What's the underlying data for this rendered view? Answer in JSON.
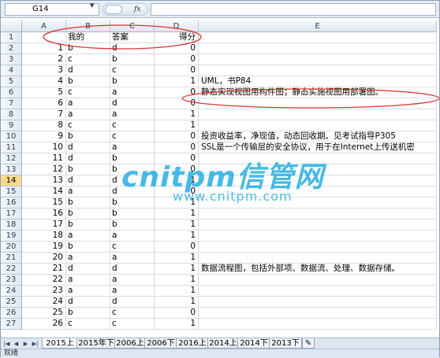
{
  "formula_bar": {
    "name_box": "G14",
    "fx_label": "fx",
    "formula": ""
  },
  "sheet": {
    "columns": [
      "A",
      "B",
      "C",
      "D",
      "E"
    ],
    "header_row": {
      "row": "1",
      "A": "",
      "B": "我的",
      "C": "答案",
      "D": "得分",
      "E": ""
    },
    "active_row": "14",
    "rows": [
      {
        "row": "2",
        "A": "1",
        "B": "b",
        "C": "d",
        "D": "0",
        "E": ""
      },
      {
        "row": "3",
        "A": "2",
        "B": "c",
        "C": "b",
        "D": "0",
        "E": ""
      },
      {
        "row": "4",
        "A": "3",
        "B": "d",
        "C": "c",
        "D": "0",
        "E": ""
      },
      {
        "row": "5",
        "A": "4",
        "B": "b",
        "C": "b",
        "D": "1",
        "E": "UML，书P84"
      },
      {
        "row": "6",
        "A": "5",
        "B": "c",
        "C": "a",
        "D": "0",
        "E": "静态实现视图用构件图；静态实施视图用部署图。"
      },
      {
        "row": "7",
        "A": "6",
        "B": "a",
        "C": "d",
        "D": "0",
        "E": ""
      },
      {
        "row": "8",
        "A": "7",
        "B": "a",
        "C": "a",
        "D": "1",
        "E": ""
      },
      {
        "row": "9",
        "A": "8",
        "B": "c",
        "C": "c",
        "D": "1",
        "E": ""
      },
      {
        "row": "10",
        "A": "9",
        "B": "b",
        "C": "c",
        "D": "0",
        "E": "投资收益率，净现值，动态回收期。见考试指导P305"
      },
      {
        "row": "11",
        "A": "10",
        "B": "d",
        "C": "a",
        "D": "0",
        "E": "SSL是一个传输层的安全协议，用于在Internet上传送机密"
      },
      {
        "row": "12",
        "A": "11",
        "B": "d",
        "C": "b",
        "D": "0",
        "E": ""
      },
      {
        "row": "13",
        "A": "12",
        "B": "b",
        "C": "b",
        "D": "0",
        "E": ""
      },
      {
        "row": "14",
        "A": "13",
        "B": "d",
        "C": "d",
        "D": "1",
        "E": ""
      },
      {
        "row": "15",
        "A": "14",
        "B": "a",
        "C": "d",
        "D": "0",
        "E": ""
      },
      {
        "row": "16",
        "A": "15",
        "B": "b",
        "C": "b",
        "D": "1",
        "E": ""
      },
      {
        "row": "17",
        "A": "16",
        "B": "b",
        "C": "b",
        "D": "1",
        "E": ""
      },
      {
        "row": "18",
        "A": "17",
        "B": "b",
        "C": "b",
        "D": "1",
        "E": ""
      },
      {
        "row": "19",
        "A": "18",
        "B": "a",
        "C": "a",
        "D": "1",
        "E": ""
      },
      {
        "row": "20",
        "A": "19",
        "B": "b",
        "C": "c",
        "D": "0",
        "E": ""
      },
      {
        "row": "21",
        "A": "20",
        "B": "a",
        "C": "a",
        "D": "1",
        "E": ""
      },
      {
        "row": "22",
        "A": "21",
        "B": "d",
        "C": "d",
        "D": "1",
        "E": "数据流程图，包括外部项、数据流、处理、数据存储。"
      },
      {
        "row": "23",
        "A": "22",
        "B": "a",
        "C": "a",
        "D": "1",
        "E": ""
      },
      {
        "row": "24",
        "A": "23",
        "B": "a",
        "C": "a",
        "D": "1",
        "E": ""
      },
      {
        "row": "25",
        "A": "24",
        "B": "d",
        "C": "d",
        "D": "1",
        "E": ""
      },
      {
        "row": "26",
        "A": "25",
        "B": "b",
        "C": "c",
        "D": "0",
        "E": ""
      },
      {
        "row": "27",
        "A": "26",
        "B": "c",
        "C": "c",
        "D": "1",
        "E": ""
      }
    ]
  },
  "watermark": {
    "logo": "cnitpm信管网",
    "url": "www.cnitpm.com"
  },
  "tabs": [
    "2015上",
    "2015年下",
    "2006上",
    "2006下",
    "2016上",
    "2014上",
    "2014下",
    "2013下"
  ],
  "active_tab": "2015上",
  "status_text": "就绪",
  "colors": {
    "annotation_red": "#e03030",
    "watermark_blue": "#00a0dc",
    "active_row_header": "#f8d98b"
  }
}
